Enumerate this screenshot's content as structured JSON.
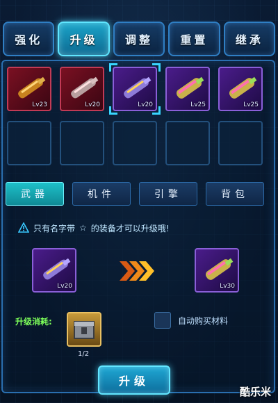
{
  "top_tabs": [
    "强化",
    "升级",
    "调整",
    "重置",
    "继承"
  ],
  "top_tabs_active": "升级",
  "equipment_slots": [
    {
      "level": "Lv23",
      "rarity": "red"
    },
    {
      "level": "Lv20",
      "rarity": "red"
    },
    {
      "level": "Lv20",
      "rarity": "purple",
      "selected": true
    },
    {
      "level": "Lv25",
      "rarity": "purple"
    },
    {
      "level": "Lv25",
      "rarity": "purple"
    }
  ],
  "category_tabs": [
    "武器",
    "机件",
    "引擎",
    "背包"
  ],
  "category_active": "武器",
  "notice": {
    "text_before": "只有名字带",
    "star": "☆",
    "text_after": "的装备才可以升级哦!"
  },
  "upgrade": {
    "source_level": "Lv20",
    "target_level": "Lv30"
  },
  "cost": {
    "label": "升级消耗:",
    "count": "1/2"
  },
  "auto_buy_label": "自动购买材料",
  "upgrade_button": "升级",
  "watermark": "酷乐米",
  "colors": {
    "accent": "#5fe6ff",
    "frame": "#2a6fb0",
    "cost_label": "#7dff5a",
    "red_rarity": "#7a1022",
    "purple_rarity": "#4a1c8a"
  }
}
